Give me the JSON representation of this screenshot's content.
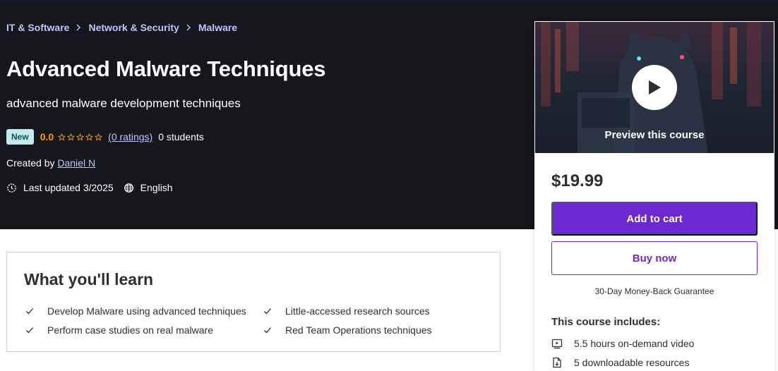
{
  "breadcrumb": [
    {
      "label": "IT & Software"
    },
    {
      "label": "Network & Security"
    },
    {
      "label": "Malware"
    }
  ],
  "course": {
    "title": "Advanced Malware Techniques",
    "subtitle": "advanced malware development techniques",
    "badge": "New",
    "rating": "0.0",
    "ratings_link": "(0 ratings)",
    "students": "0 students",
    "created_prefix": "Created by",
    "author": "Daniel N",
    "last_updated": "Last updated 3/2025",
    "language": "English"
  },
  "sidebar": {
    "preview_label": "Preview this course",
    "price": "$19.99",
    "add_to_cart": "Add to cart",
    "buy_now": "Buy now",
    "guarantee": "30-Day Money-Back Guarantee",
    "includes_title": "This course includes:",
    "includes": [
      {
        "icon": "video-icon",
        "label": "5.5 hours on-demand video"
      },
      {
        "icon": "file-download-icon",
        "label": "5 downloadable resources"
      }
    ]
  },
  "learn": {
    "title": "What you'll learn",
    "items": [
      {
        "label": "Develop Malware using advanced techniques"
      },
      {
        "label": "Little-accessed research sources"
      },
      {
        "label": "Perform case studies on real malware"
      },
      {
        "label": "Red Team Operations techniques"
      }
    ]
  },
  "colors": {
    "hero_bg": "#16161d",
    "link": "#c0c4fc",
    "rating": "#f69c08",
    "accent": "#6d28d2",
    "badge_bg": "#c2e9eb"
  }
}
